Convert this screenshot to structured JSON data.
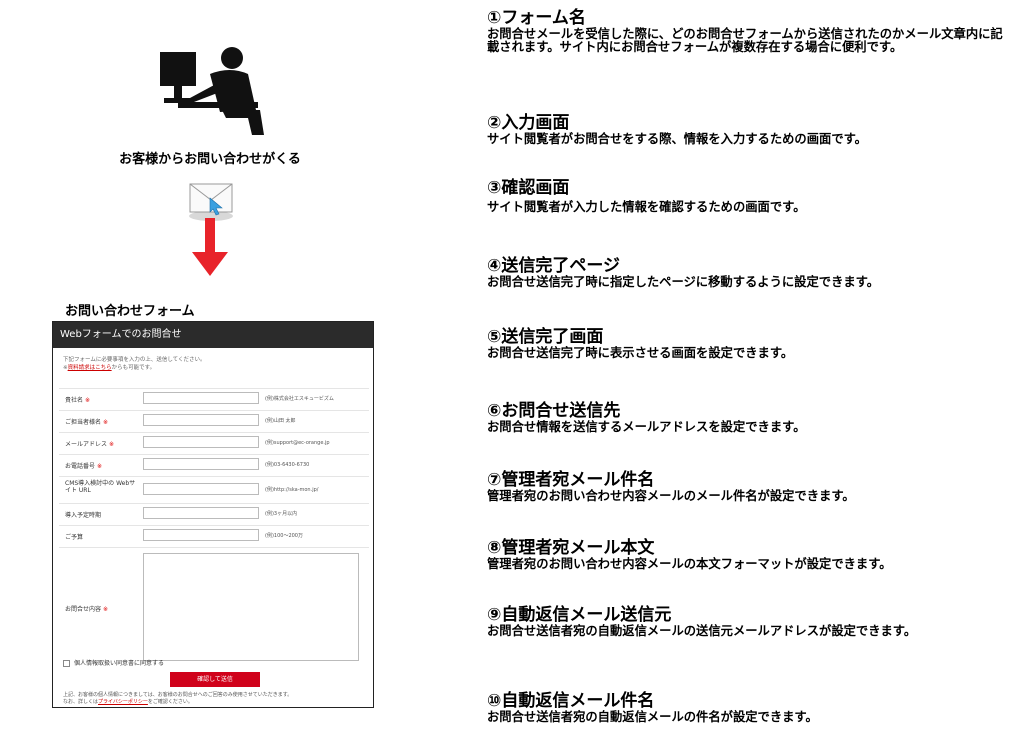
{
  "left": {
    "caption_top": "お客様からお問い合わせがくる",
    "caption_form": "お問い合わせフォーム",
    "form": {
      "title": "Webフォームでのお問合せ",
      "intro_line1": "下記フォームに必要事項を入力の上、送信してください。",
      "intro_link": "資料請求はこちら",
      "intro_line2_tail": "からも可能です。",
      "fields": [
        {
          "label": "貴社名",
          "required": true,
          "example": "(例)株式会社エスキュービズム"
        },
        {
          "label": "ご担当者様名",
          "required": true,
          "example": "(例)山田 太郎"
        },
        {
          "label": "メールアドレス",
          "required": true,
          "example": "(例)support@ec-orange.jp"
        },
        {
          "label": "お電話番号",
          "required": true,
          "example": "(例)03-6430-6730"
        },
        {
          "label": "CMS導入検討中の Webサイト URL",
          "required": false,
          "example": "(例)http://ska-mon.jp/"
        },
        {
          "label": "導入予定時期",
          "required": false,
          "example": "(例)3ヶ月以内"
        },
        {
          "label": "ご予算",
          "required": false,
          "example": "(例)100～200万"
        }
      ],
      "message_label": "お問合せ内容",
      "agree_text": "個人情報取扱い同意書に同意する",
      "submit_label": "確認して送信",
      "note_line1": "上記、お客様の個人情報につきましては、お客様のお問合せへのご回答のみ使用させていただきます。",
      "note_line2_head": "なお、詳しくは",
      "note_link": "プライバシーポリシー",
      "note_line2_tail": "をご確認ください。"
    }
  },
  "items": [
    {
      "title": "①フォーム名",
      "desc": "お問合せメールを受信した際に、どのお問合せフォームから送信されたのかメール文章内に記載されます。サイト内にお問合せフォームが複数存在する場合に便利です。"
    },
    {
      "title": "②入力画面",
      "desc": "サイト閲覧者がお問合せをする際、情報を入力するための画面です。"
    },
    {
      "title": "③確認画面",
      "desc": "サイト閲覧者が入力した情報を確認するための画面です。"
    },
    {
      "title": "④送信完了ページ",
      "desc": "お問合せ送信完了時に指定したページに移動するように設定できます。"
    },
    {
      "title": "⑤送信完了画面",
      "desc": "お問合せ送信完了時に表示させる画面を設定できます。"
    },
    {
      "title": "⑥お問合せ送信先",
      "desc": "お問合せ情報を送信するメールアドレスを設定できます。"
    },
    {
      "title": "⑦管理者宛メール件名",
      "desc": "管理者宛のお問い合わせ内容メールのメール件名が設定できます。"
    },
    {
      "title": "⑧管理者宛メール本文",
      "desc": "管理者宛のお問い合わせ内容メールの本文フォーマットが設定できます。"
    },
    {
      "title": "⑨自動返信メール送信元",
      "desc": "お問合せ送信者宛の自動返信メールの送信元メールアドレスが設定できます。"
    },
    {
      "title": "⑩自動返信メール件名",
      "desc": "お問合せ送信者宛の自動返信メールの件名が設定できます。"
    }
  ],
  "colors": {
    "accent": "#d0021b",
    "arrow": "#e8232a",
    "header": "#2b2b2b"
  }
}
